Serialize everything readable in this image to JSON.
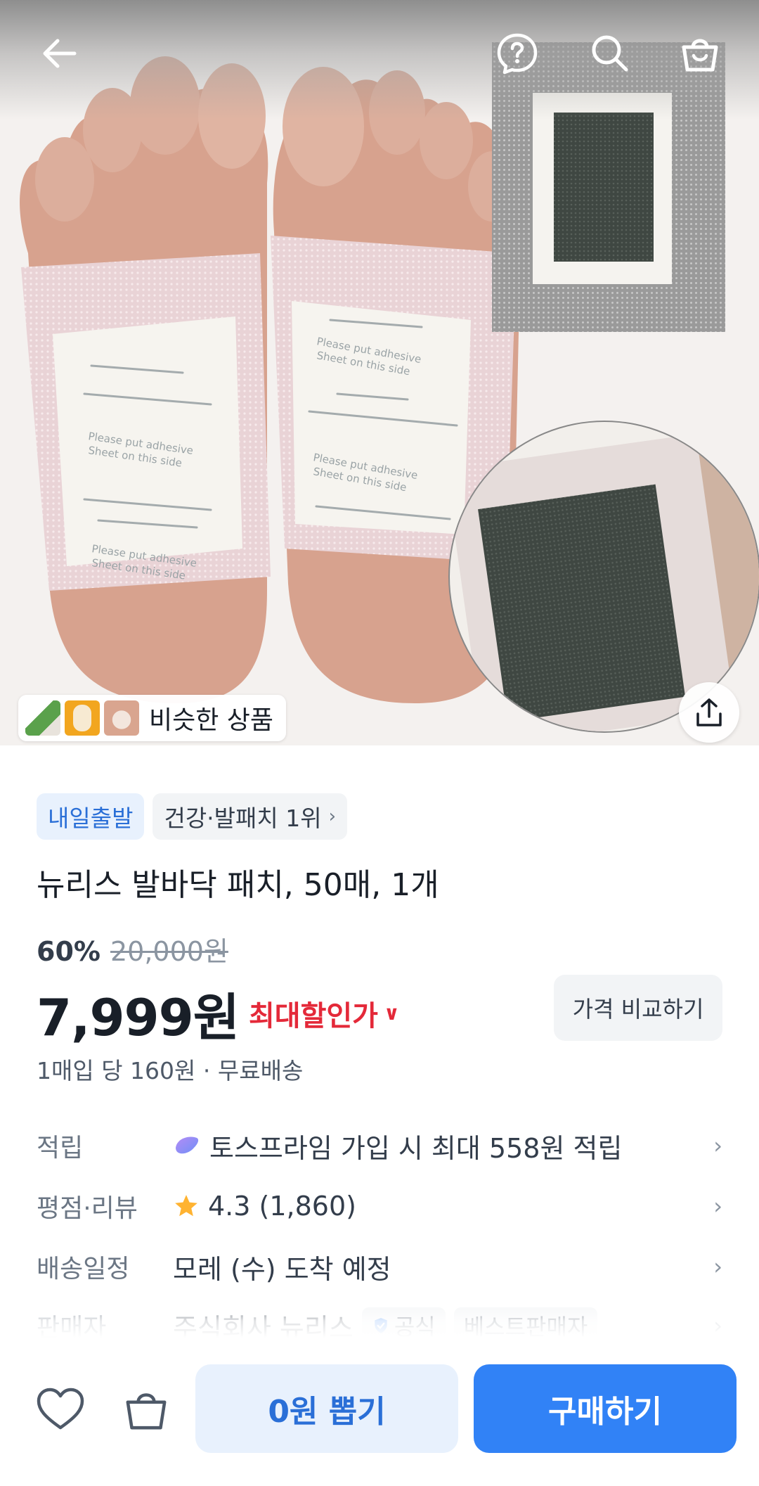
{
  "header": {
    "back_icon": "arrow-left-icon",
    "help_icon": "question-bubble-icon",
    "search_icon": "search-icon",
    "cart_icon": "shopping-bag-icon"
  },
  "hero": {
    "similar_label": "비슷한 상품",
    "share_icon": "share-icon",
    "patch_printed_text": [
      "Please put adhesive",
      "Sheet on this side"
    ]
  },
  "product": {
    "badges": {
      "delivery": "내일출발",
      "category_rank": "건강·발패치 1위"
    },
    "title": "뉴리스 발바닥 패치, 50매, 1개",
    "discount_pct": "60%",
    "original_price": "20,000원",
    "price": "7,999원",
    "max_discount_label": "최대할인가",
    "compare_button": "가격 비교하기",
    "unit_price": "1매입 당 160원 · 무료배송"
  },
  "info": {
    "points": {
      "label": "적립",
      "value": "토스프라임 가입 시 최대 558원 적립"
    },
    "rating": {
      "label": "평점·리뷰",
      "value": "4.3 (1,860)"
    },
    "shipping": {
      "label": "배송일정",
      "value": "모레 (수) 도착 예정"
    },
    "seller": {
      "label": "판매자",
      "value": "주식회사 뉴리스",
      "official": "공식",
      "best": "베스트판매자"
    }
  },
  "bottom": {
    "draw_button": "0원 뽑기",
    "buy_button": "구매하기"
  },
  "colors": {
    "accent_blue": "#3182f6",
    "badge_blue_bg": "#e8f1fd",
    "discount_red": "#e42939",
    "star_yellow": "#ffb331"
  }
}
